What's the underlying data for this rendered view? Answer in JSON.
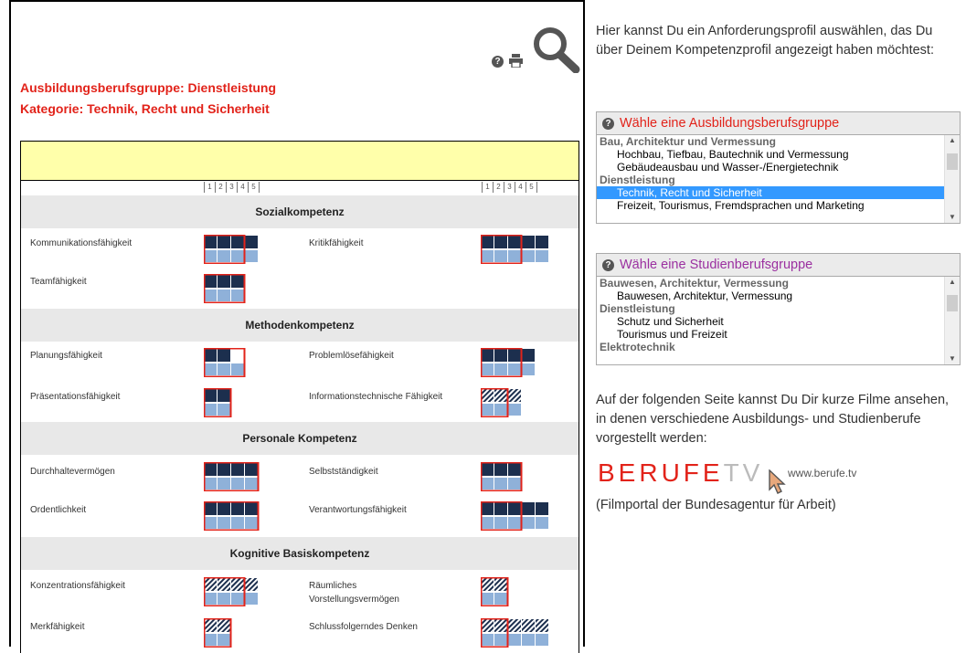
{
  "header": {
    "group_heading": "Ausbildungsberufsgruppe: Dienstleistung",
    "category_heading": "Kategorie: Technik, Recht und Sicherheit"
  },
  "toolbar": {
    "help": "?"
  },
  "profile": {
    "scale": [
      "1",
      "2",
      "3",
      "4",
      "5"
    ],
    "sections": [
      {
        "title": "Sozialkompetenz",
        "items": [
          {
            "label": "Kommunikationsfähigkeit",
            "level": 4,
            "required": 3,
            "style": "solid"
          },
          {
            "label": "Kritikfähigkeit",
            "level": 5,
            "required": 3,
            "style": "solid"
          },
          {
            "label": "Teamfähigkeit",
            "level": 3,
            "required": 3,
            "style": "solid"
          }
        ]
      },
      {
        "title": "Methodenkompetenz",
        "items": [
          {
            "label": "Planungsfähigkeit",
            "level": 2,
            "required": 3,
            "style": "solid"
          },
          {
            "label": "Problemlösefähigkeit",
            "level": 4,
            "required": 3,
            "style": "solid"
          },
          {
            "label": "Präsentationsfähigkeit",
            "level": 2,
            "required": 2,
            "style": "solid"
          },
          {
            "label": "Informationstechnische Fähigkeit",
            "level": 3,
            "required": 2,
            "style": "hatched"
          }
        ]
      },
      {
        "title": "Personale Kompetenz",
        "items": [
          {
            "label": "Durchhaltevermögen",
            "level": 4,
            "required": 4,
            "style": "solid"
          },
          {
            "label": "Selbstständigkeit",
            "level": 3,
            "required": 3,
            "style": "solid"
          },
          {
            "label": "Ordentlichkeit",
            "level": 4,
            "required": 4,
            "style": "solid"
          },
          {
            "label": "Verantwortungsfähigkeit",
            "level": 5,
            "required": 3,
            "style": "solid"
          }
        ]
      },
      {
        "title": "Kognitive Basiskompetenz",
        "items": [
          {
            "label": "Konzentrationsfähigkeit",
            "level": 4,
            "required": 3,
            "style": "hatched"
          },
          {
            "label": "Räumliches Vorstellungsvermögen",
            "level": 2,
            "required": 2,
            "style": "hatched"
          },
          {
            "label": "Merkfähigkeit",
            "level": 2,
            "required": 2,
            "style": "hatched"
          },
          {
            "label": "Schlussfolgerndes Denken",
            "level": 5,
            "required": 2,
            "style": "hatched"
          }
        ]
      }
    ]
  },
  "sidebar": {
    "intro": "Hier kannst Du ein Anforderungsprofil auswählen, das Du über Deinem Kompetenzprofil angezeigt haben möchtest:",
    "ausbildung": {
      "label": "Wähle eine Ausbildungsberufsgruppe",
      "color": "#e2231a",
      "options": [
        {
          "text": "Bau, Architektur und Vermessung",
          "type": "group"
        },
        {
          "text": "Hochbau, Tiefbau, Bautechnik und Vermessung",
          "type": "option"
        },
        {
          "text": "Gebäudeausbau und Wasser-/Energietechnik",
          "type": "option"
        },
        {
          "text": "Dienstleistung",
          "type": "group"
        },
        {
          "text": "Technik, Recht und Sicherheit",
          "type": "selected"
        },
        {
          "text": "Freizeit, Tourismus, Fremdsprachen und Marketing",
          "type": "option"
        }
      ]
    },
    "studium": {
      "label": "Wähle eine Studienberufsgruppe",
      "color": "#9b30a0",
      "options": [
        {
          "text": "Bauwesen, Architektur, Vermessung",
          "type": "group"
        },
        {
          "text": "Bauwesen, Architektur, Vermessung",
          "type": "option"
        },
        {
          "text": "Dienstleistung",
          "type": "group"
        },
        {
          "text": "Schutz und Sicherheit",
          "type": "option"
        },
        {
          "text": "Tourismus und Freizeit",
          "type": "option"
        },
        {
          "text": "Elektrotechnik",
          "type": "group"
        }
      ]
    },
    "films_text": "Auf der folgenden Seite kannst Du Dir kurze Filme ansehen, in denen verschiedene Ausbildungs- und Studienberufe vorgestellt werden:",
    "berufe_logo": "BERUFE",
    "berufe_tv": "TV",
    "berufe_url": "www.berufe.tv",
    "portal_note": "(Filmportal der Bundesagentur für Arbeit)"
  },
  "colors": {
    "accent": "#e2231a",
    "dark": "#1c2f4e",
    "light": "#8fb1d9",
    "yellow": "#ffffaa"
  }
}
